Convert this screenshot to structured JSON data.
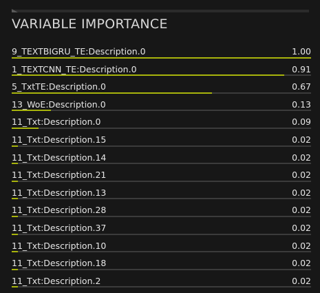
{
  "panel": {
    "title": "VARIABLE IMPORTANCE",
    "accent_color": "#a8b40c",
    "track_color": "#3b3b3b"
  },
  "variables": [
    {
      "label": "9_TEXTBIGRU_TE:Description.0",
      "value": "1.00",
      "importance": 1.0
    },
    {
      "label": "1_TEXTCNN_TE:Description.0",
      "value": "0.91",
      "importance": 0.91
    },
    {
      "label": "5_TxtTE:Description.0",
      "value": "0.67",
      "importance": 0.67
    },
    {
      "label": "13_WoE:Description.0",
      "value": "0.13",
      "importance": 0.13
    },
    {
      "label": "11_Txt:Description.0",
      "value": "0.09",
      "importance": 0.09
    },
    {
      "label": "11_Txt:Description.15",
      "value": "0.02",
      "importance": 0.02
    },
    {
      "label": "11_Txt:Description.14",
      "value": "0.02",
      "importance": 0.02
    },
    {
      "label": "11_Txt:Description.21",
      "value": "0.02",
      "importance": 0.02
    },
    {
      "label": "11_Txt:Description.13",
      "value": "0.02",
      "importance": 0.02
    },
    {
      "label": "11_Txt:Description.28",
      "value": "0.02",
      "importance": 0.02
    },
    {
      "label": "11_Txt:Description.37",
      "value": "0.02",
      "importance": 0.02
    },
    {
      "label": "11_Txt:Description.10",
      "value": "0.02",
      "importance": 0.02
    },
    {
      "label": "11_Txt:Description.18",
      "value": "0.02",
      "importance": 0.02
    },
    {
      "label": "11_Txt:Description.2",
      "value": "0.02",
      "importance": 0.02
    }
  ]
}
